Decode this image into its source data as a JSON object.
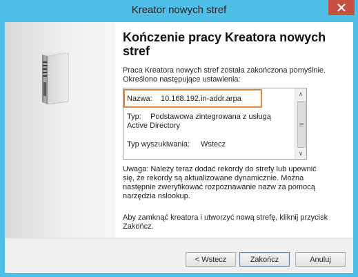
{
  "window": {
    "title": "Kreator nowych stref",
    "close_glyph": "✕"
  },
  "page": {
    "heading": "Kończenie pracy Kreatora nowych stref",
    "intro": "Praca Kreatora nowych stref została zakończona pomyślnie. Określono następujące ustawienia:"
  },
  "summary": {
    "name_label": "Nazwa:",
    "name_value": "10.168.192.in-addr.arpa",
    "type_label": "Typ:",
    "type_value_line1": "Podstawowa zintegrowana z usługą",
    "type_value_line2": "Active Directory",
    "lookup_label": "Typ wyszukiwania:",
    "lookup_value": "Wstecz",
    "scroll_up": "∧",
    "scroll_down": "∨"
  },
  "note": "Uwaga: Należy teraz dodać rekordy do strefy lub upewnić się, że rekordy są aktualizowane dynamicznie. Można następnie zweryfikować rozpoznawanie nazw za pomocą narzędzia nslookup.",
  "close_note": "Aby zamknąć kreatora i utworzyć nową strefę, kliknij przycisk Zakończ.",
  "buttons": {
    "back": "< Wstecz",
    "finish": "Zakończ",
    "cancel": "Anuluj"
  },
  "colors": {
    "titlebar": "#4fbfe8",
    "close_button": "#c7503f",
    "highlight": "#e7873d"
  },
  "icons": {
    "wizard": "server-icon",
    "close": "close-icon"
  }
}
